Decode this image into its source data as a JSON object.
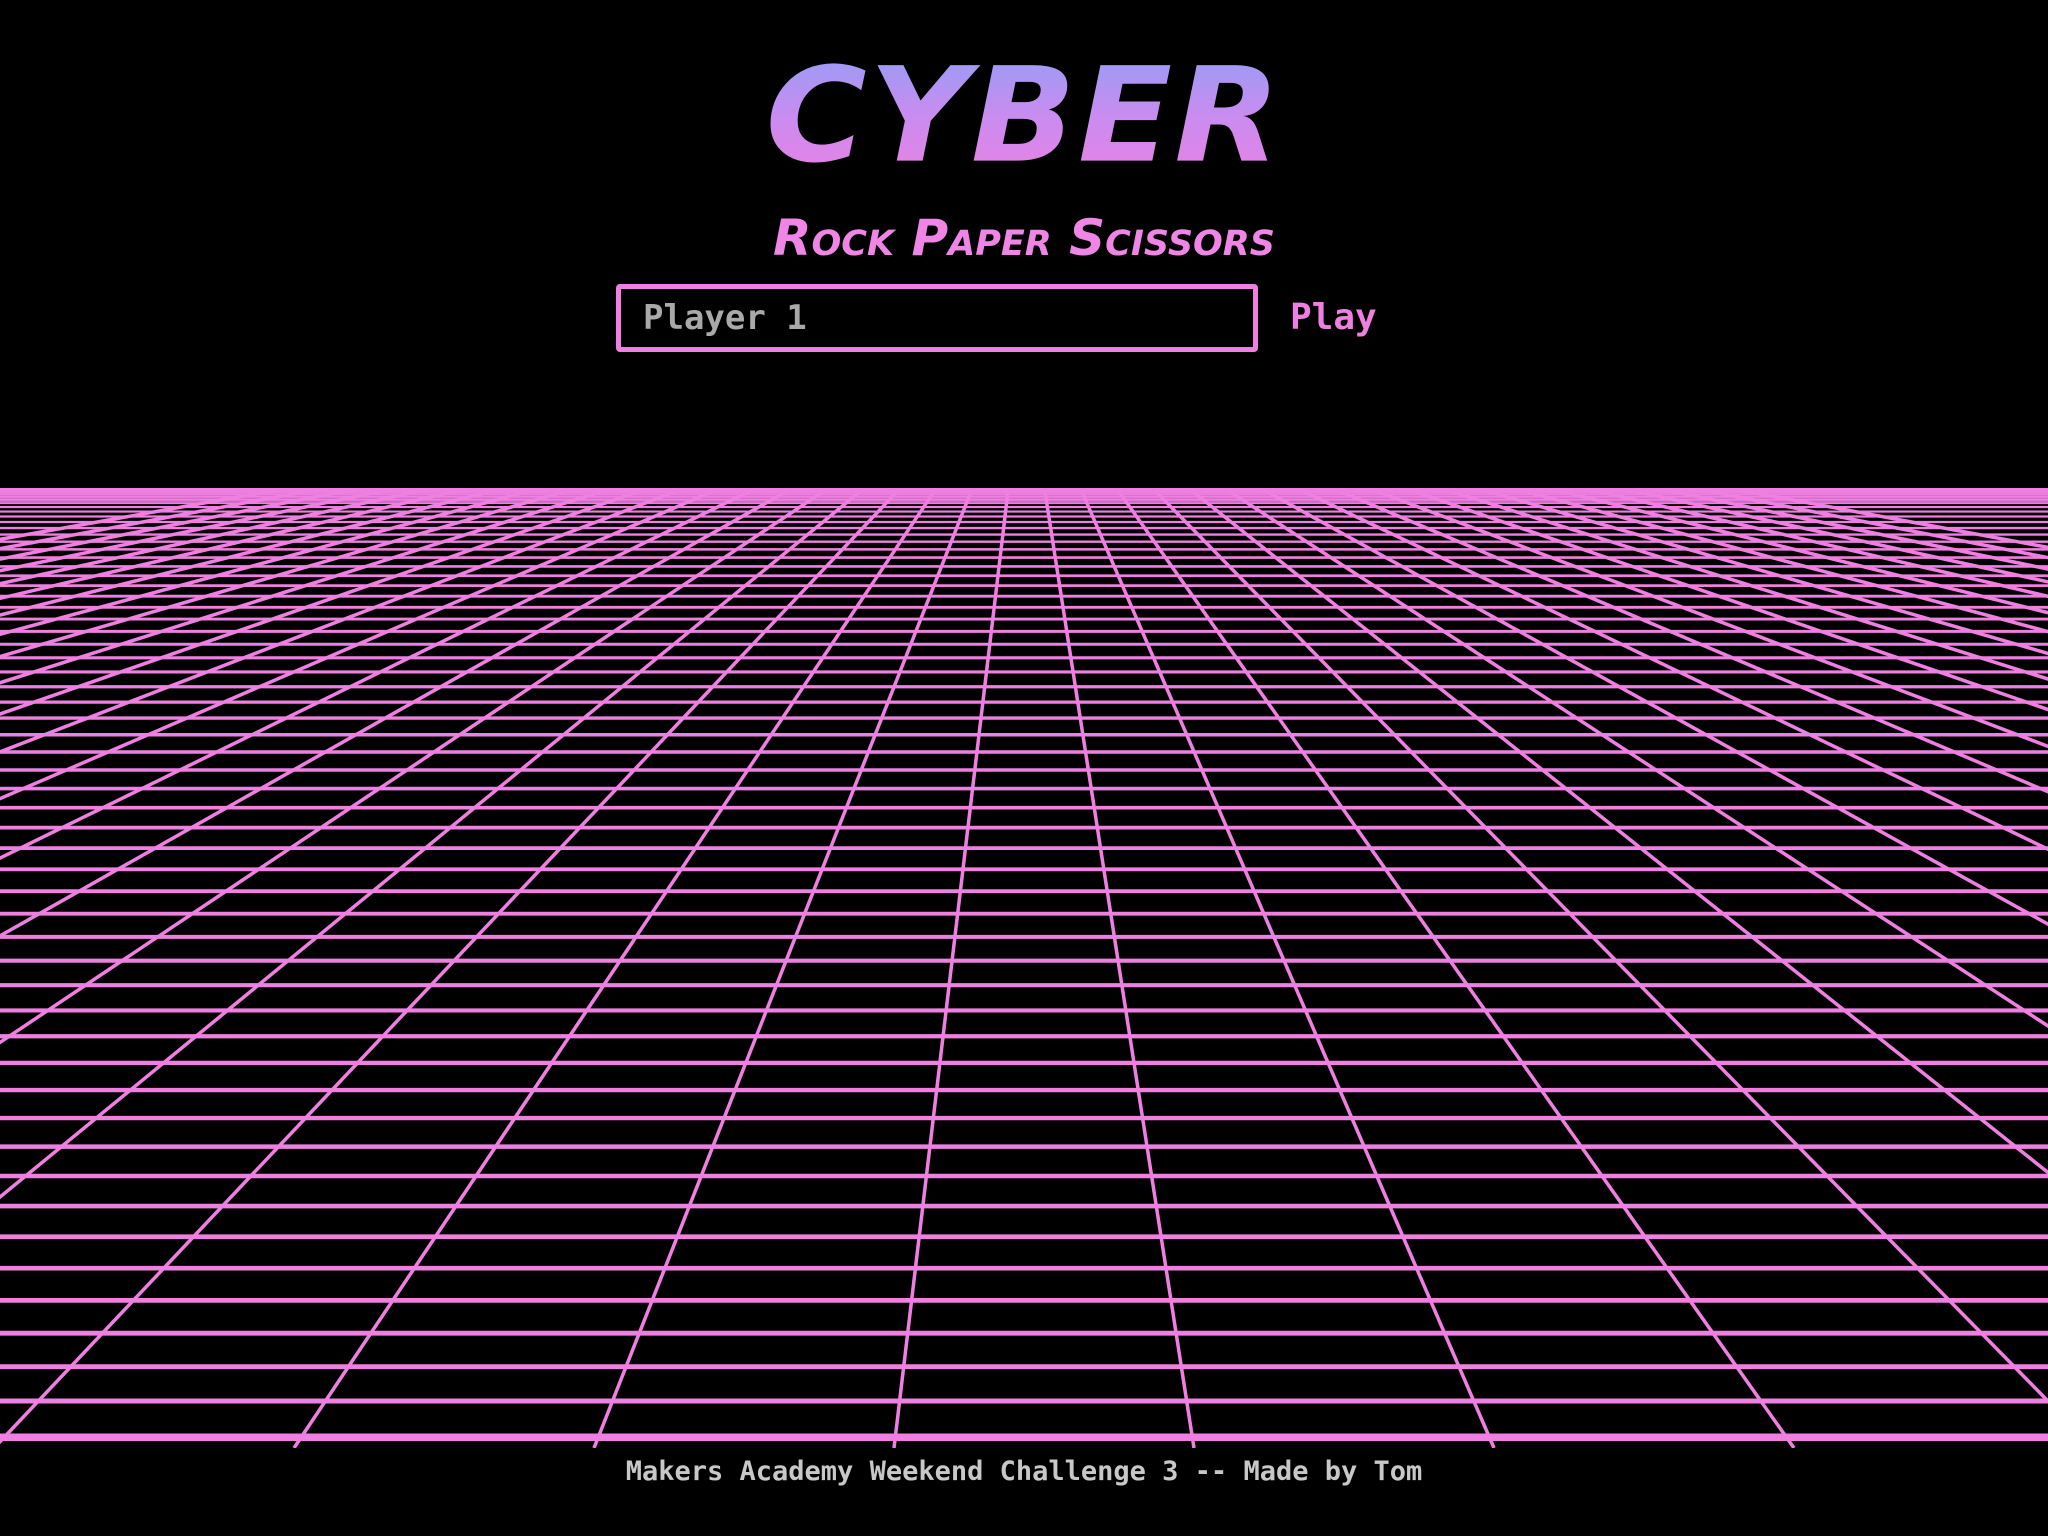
{
  "header": {
    "logo_text": "CYBER",
    "subtitle": "Rock Paper Scissors"
  },
  "form": {
    "name_placeholder": "Player 1",
    "name_value": "",
    "play_label": "Play"
  },
  "footer": {
    "text": "Makers Academy Weekend Challenge 3 -- Made by Tom"
  },
  "theme": {
    "background": "#000000",
    "accent": "#f07fe2",
    "logo_gradient_top": "#8fa0f6",
    "logo_gradient_bottom": "#f07fe2",
    "footer_text": "#c8c8c8"
  }
}
